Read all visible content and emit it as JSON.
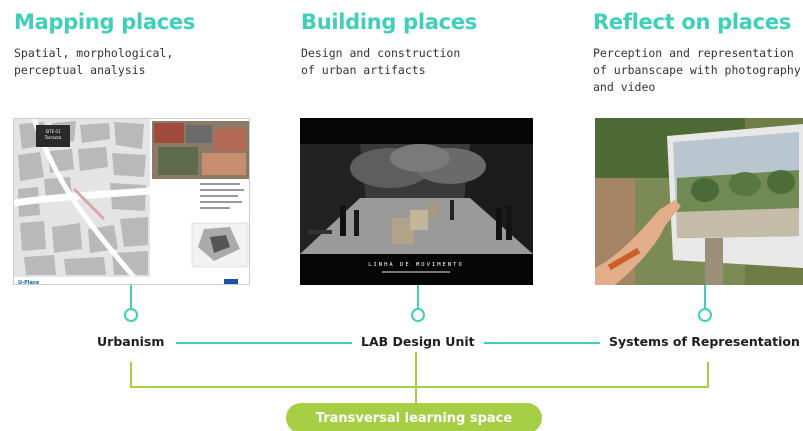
{
  "columns": [
    {
      "title": "Mapping places",
      "description": "Spatial, morphological,\nperceptual analysis",
      "image": "urban-map-photo",
      "unit": "Urbanism"
    },
    {
      "title": "Building places",
      "description": "Design and construction\nof urban artifacts",
      "image": "street-installation-photo",
      "caption": "LINHA DE MOVIMENTO",
      "unit": "LAB Design Unit"
    },
    {
      "title": "Reflect on places",
      "description": "Perception and representation\nof urbanscape with photography\nand video",
      "image": "hand-holding-photo",
      "unit": "Systems of Representation"
    }
  ],
  "map_panel": {
    "site_label": "SITE 01\nTorrazza",
    "logo_text": "U-Place"
  },
  "footer": {
    "label": "Transversal learning space"
  },
  "colors": {
    "teal": "#3fd0ba",
    "lime": "#a6cf45"
  }
}
